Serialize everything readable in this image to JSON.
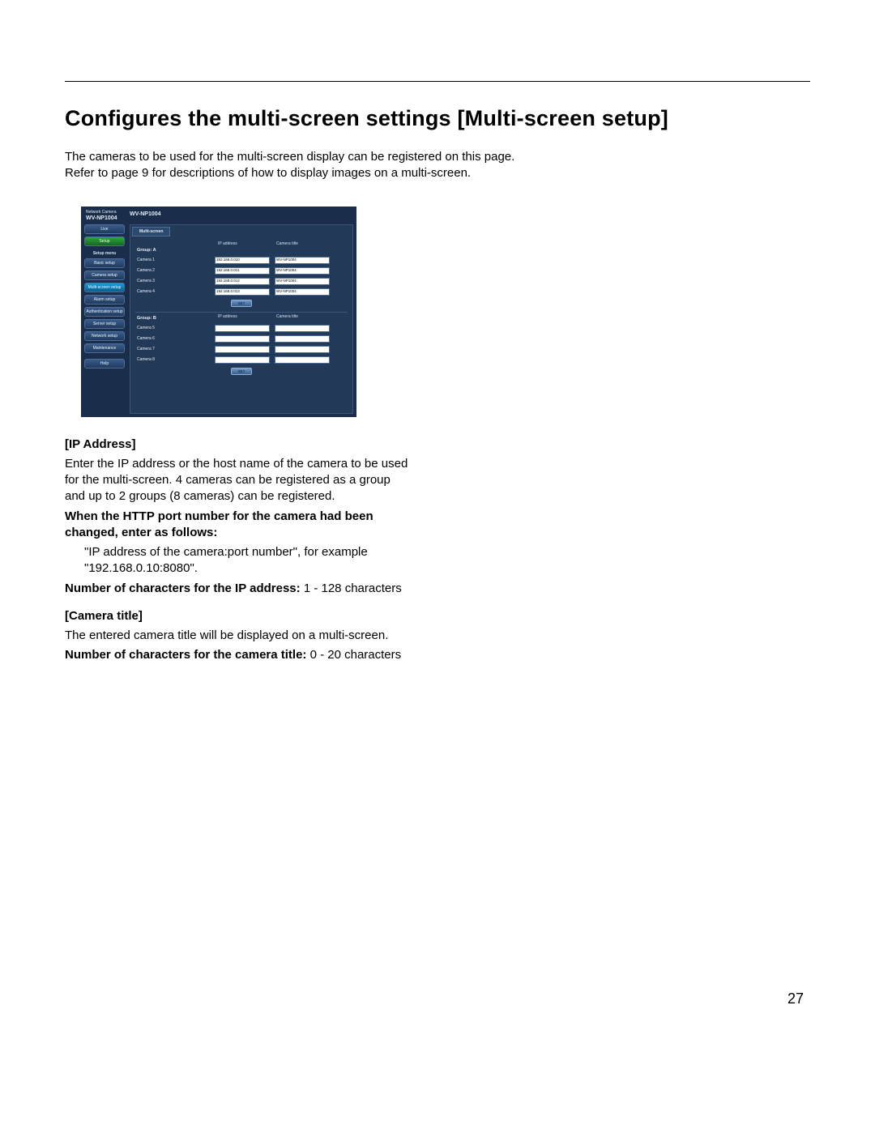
{
  "page": {
    "title": "Configures the multi-screen settings [Multi-screen setup]",
    "intro_l1": "The cameras to be used for the multi-screen display can be registered on this page.",
    "intro_l2": "Refer to page 9 for descriptions of how to display images on a multi-screen.",
    "number": "27"
  },
  "shot": {
    "brand_line1": "Network Camera",
    "brand_model": "WV-NP1004",
    "top_model": "WV-NP1004",
    "side": {
      "live": "Live",
      "setup": "Setup",
      "menu_head": "Setup menu",
      "items": {
        "basic": "Basic setup",
        "camera": "Camera setup",
        "multi": "Multi-screen setup",
        "alarm": "Alarm setup",
        "auth": "Authentication setup",
        "server": "Server setup",
        "network": "Network setup",
        "maint": "Maintenance"
      },
      "help": "Help"
    },
    "main": {
      "tab": "Multi-screen",
      "col_ip": "IP address",
      "col_title": "Camera title",
      "set": "SET",
      "groupA": {
        "name": "Group: A",
        "rows": [
          {
            "lbl": "Camera 1",
            "ip": "192.168.0.010",
            "title": "WV-NP1004"
          },
          {
            "lbl": "Camera 2",
            "ip": "192.168.0.011",
            "title": "WV-NP1004"
          },
          {
            "lbl": "Camera 3",
            "ip": "192.168.0.012",
            "title": "WV-NP1004"
          },
          {
            "lbl": "Camera 4",
            "ip": "192.168.0.013",
            "title": "WV-NP1004"
          }
        ]
      },
      "groupB": {
        "name": "Group: B",
        "rows": [
          {
            "lbl": "Camera 5",
            "ip": "",
            "title": ""
          },
          {
            "lbl": "Camera 6",
            "ip": "",
            "title": ""
          },
          {
            "lbl": "Camera 7",
            "ip": "",
            "title": ""
          },
          {
            "lbl": "Camera 8",
            "ip": "",
            "title": ""
          }
        ]
      }
    }
  },
  "body": {
    "ip_head": "[IP Address]",
    "ip_p1": "Enter the IP address or the host name of the camera to be used for the multi-screen. 4 cameras can be registered as a group and up to 2 groups (8 cameras) can be registered.",
    "ip_port_b1": "When the HTTP port number for the camera had been changed, enter as follows:",
    "ip_port_p1": "\"IP address of the camera:port number\", for example \"192.168.0.10:8080\".",
    "ip_chars_b": "Number of characters for the IP address: ",
    "ip_chars_v": "1 - 128 characters",
    "cam_head": "[Camera title]",
    "cam_p1": "The entered camera title will be displayed on a multi-screen.",
    "cam_chars_b": "Number of characters for the camera title: ",
    "cam_chars_v": "0 - 20 characters"
  }
}
